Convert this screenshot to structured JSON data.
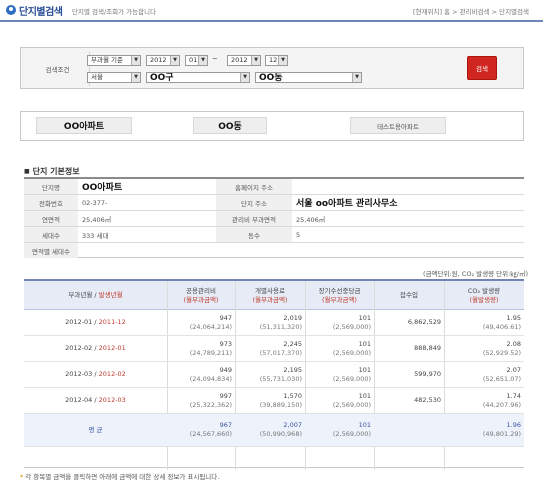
{
  "header": {
    "title": "단지별검색",
    "description": "단지별 검색/조회가 가능합니다",
    "breadcrumb": "[현재위치] 홈 > 관리비검색 > 단지별검색"
  },
  "search": {
    "label": "검색조건",
    "period_type": "부과월 기준",
    "from_year": "2012",
    "from_month": "01",
    "to_year": "2012",
    "to_month": "12",
    "tilde": "~",
    "region": "서울",
    "district": "OO구",
    "dong": "OO동",
    "button_label": "검색"
  },
  "results": {
    "apartment": "OO아파트",
    "dong": "OO동",
    "test_apartment": "테스트용아파트"
  },
  "basic_info": {
    "section_title": "단지 기본정보",
    "rows": [
      [
        {
          "label": "단지명",
          "value": "OO아파트",
          "big": true
        },
        {
          "label": "홈페이지 주소",
          "value": ""
        }
      ],
      [
        {
          "label": "전화번호",
          "value": "02-377-"
        },
        {
          "label": "단지 주소",
          "value": "서울 oo아파트 관리사무소",
          "big": true
        }
      ],
      [
        {
          "label": "연면적",
          "value": "25,406㎡"
        },
        {
          "label": "관리비 부과면적",
          "value": "25,406㎡"
        }
      ],
      [
        {
          "label": "세대수",
          "value": "333 세대"
        },
        {
          "label": "동수",
          "value": "5"
        }
      ],
      [
        {
          "label": "면적별 세대수",
          "value": ""
        }
      ]
    ]
  },
  "fee_table": {
    "unit_note": "(금액단위:원, CO₂ 발생량 단위:㎏/㎡)",
    "headers": [
      {
        "line1": "부과년월 / ",
        "line1b": "발생년월",
        "line2": ""
      },
      {
        "line1": "공용관리비",
        "line2": "(월부과금액)"
      },
      {
        "line1": "개별사용료",
        "line2": "(월부과금액)"
      },
      {
        "line1": "장기수선충당금",
        "line2": "(월부과금액)"
      },
      {
        "line1": "잡수입",
        "line2": ""
      },
      {
        "line1": "CO₂ 발생량",
        "line2": "(월발생량)"
      }
    ],
    "rows": [
      {
        "period": "2012-01",
        "occur": "2011-12",
        "common": "947",
        "common_total": "(24,064,214)",
        "individual": "2,019",
        "individual_total": "(51,311,320)",
        "ltr": "101",
        "ltr_total": "(2,569,000)",
        "misc": "6,862,529",
        "co2": "1.95",
        "co2_total": "(49,406.61)"
      },
      {
        "period": "2012-02",
        "occur": "2012-01",
        "common": "973",
        "common_total": "(24,789,211)",
        "individual": "2,245",
        "individual_total": "(57,017,370)",
        "ltr": "101",
        "ltr_total": "(2,569,000)",
        "misc": "888,849",
        "co2": "2.08",
        "co2_total": "(52,929.52)"
      },
      {
        "period": "2012-03",
        "occur": "2012-02",
        "common": "949",
        "common_total": "(24,094,834)",
        "individual": "2,195",
        "individual_total": "(55,731,030)",
        "ltr": "101",
        "ltr_total": "(2,569,000)",
        "misc": "599,970",
        "co2": "2.07",
        "co2_total": "(52,651.07)"
      },
      {
        "period": "2012-04",
        "occur": "2012-03",
        "common": "997",
        "common_total": "(25,322,362)",
        "individual": "1,570",
        "individual_total": "(39,889,150)",
        "ltr": "101",
        "ltr_total": "(2,569,000)",
        "misc": "482,530",
        "co2": "1.74",
        "co2_total": "(44,207.96)"
      }
    ],
    "average": {
      "label": "평 균",
      "common": "967",
      "common_total": "(24,567,660)",
      "individual": "2,007",
      "individual_total": "(50,990,968)",
      "ltr": "101",
      "ltr_total": "(2,569,000)",
      "misc": "",
      "co2": "1.96",
      "co2_total": "(49,801.29)"
    }
  },
  "notes": {
    "line1": "각 항목별 금액을 클릭하면 아래에 금액에 대한 상세 정보가 표시됩니다."
  },
  "colors": {
    "accent_blue": "#2b4f97",
    "search_button": "#d0261f",
    "table_header_bg": "#e6ebf6"
  }
}
